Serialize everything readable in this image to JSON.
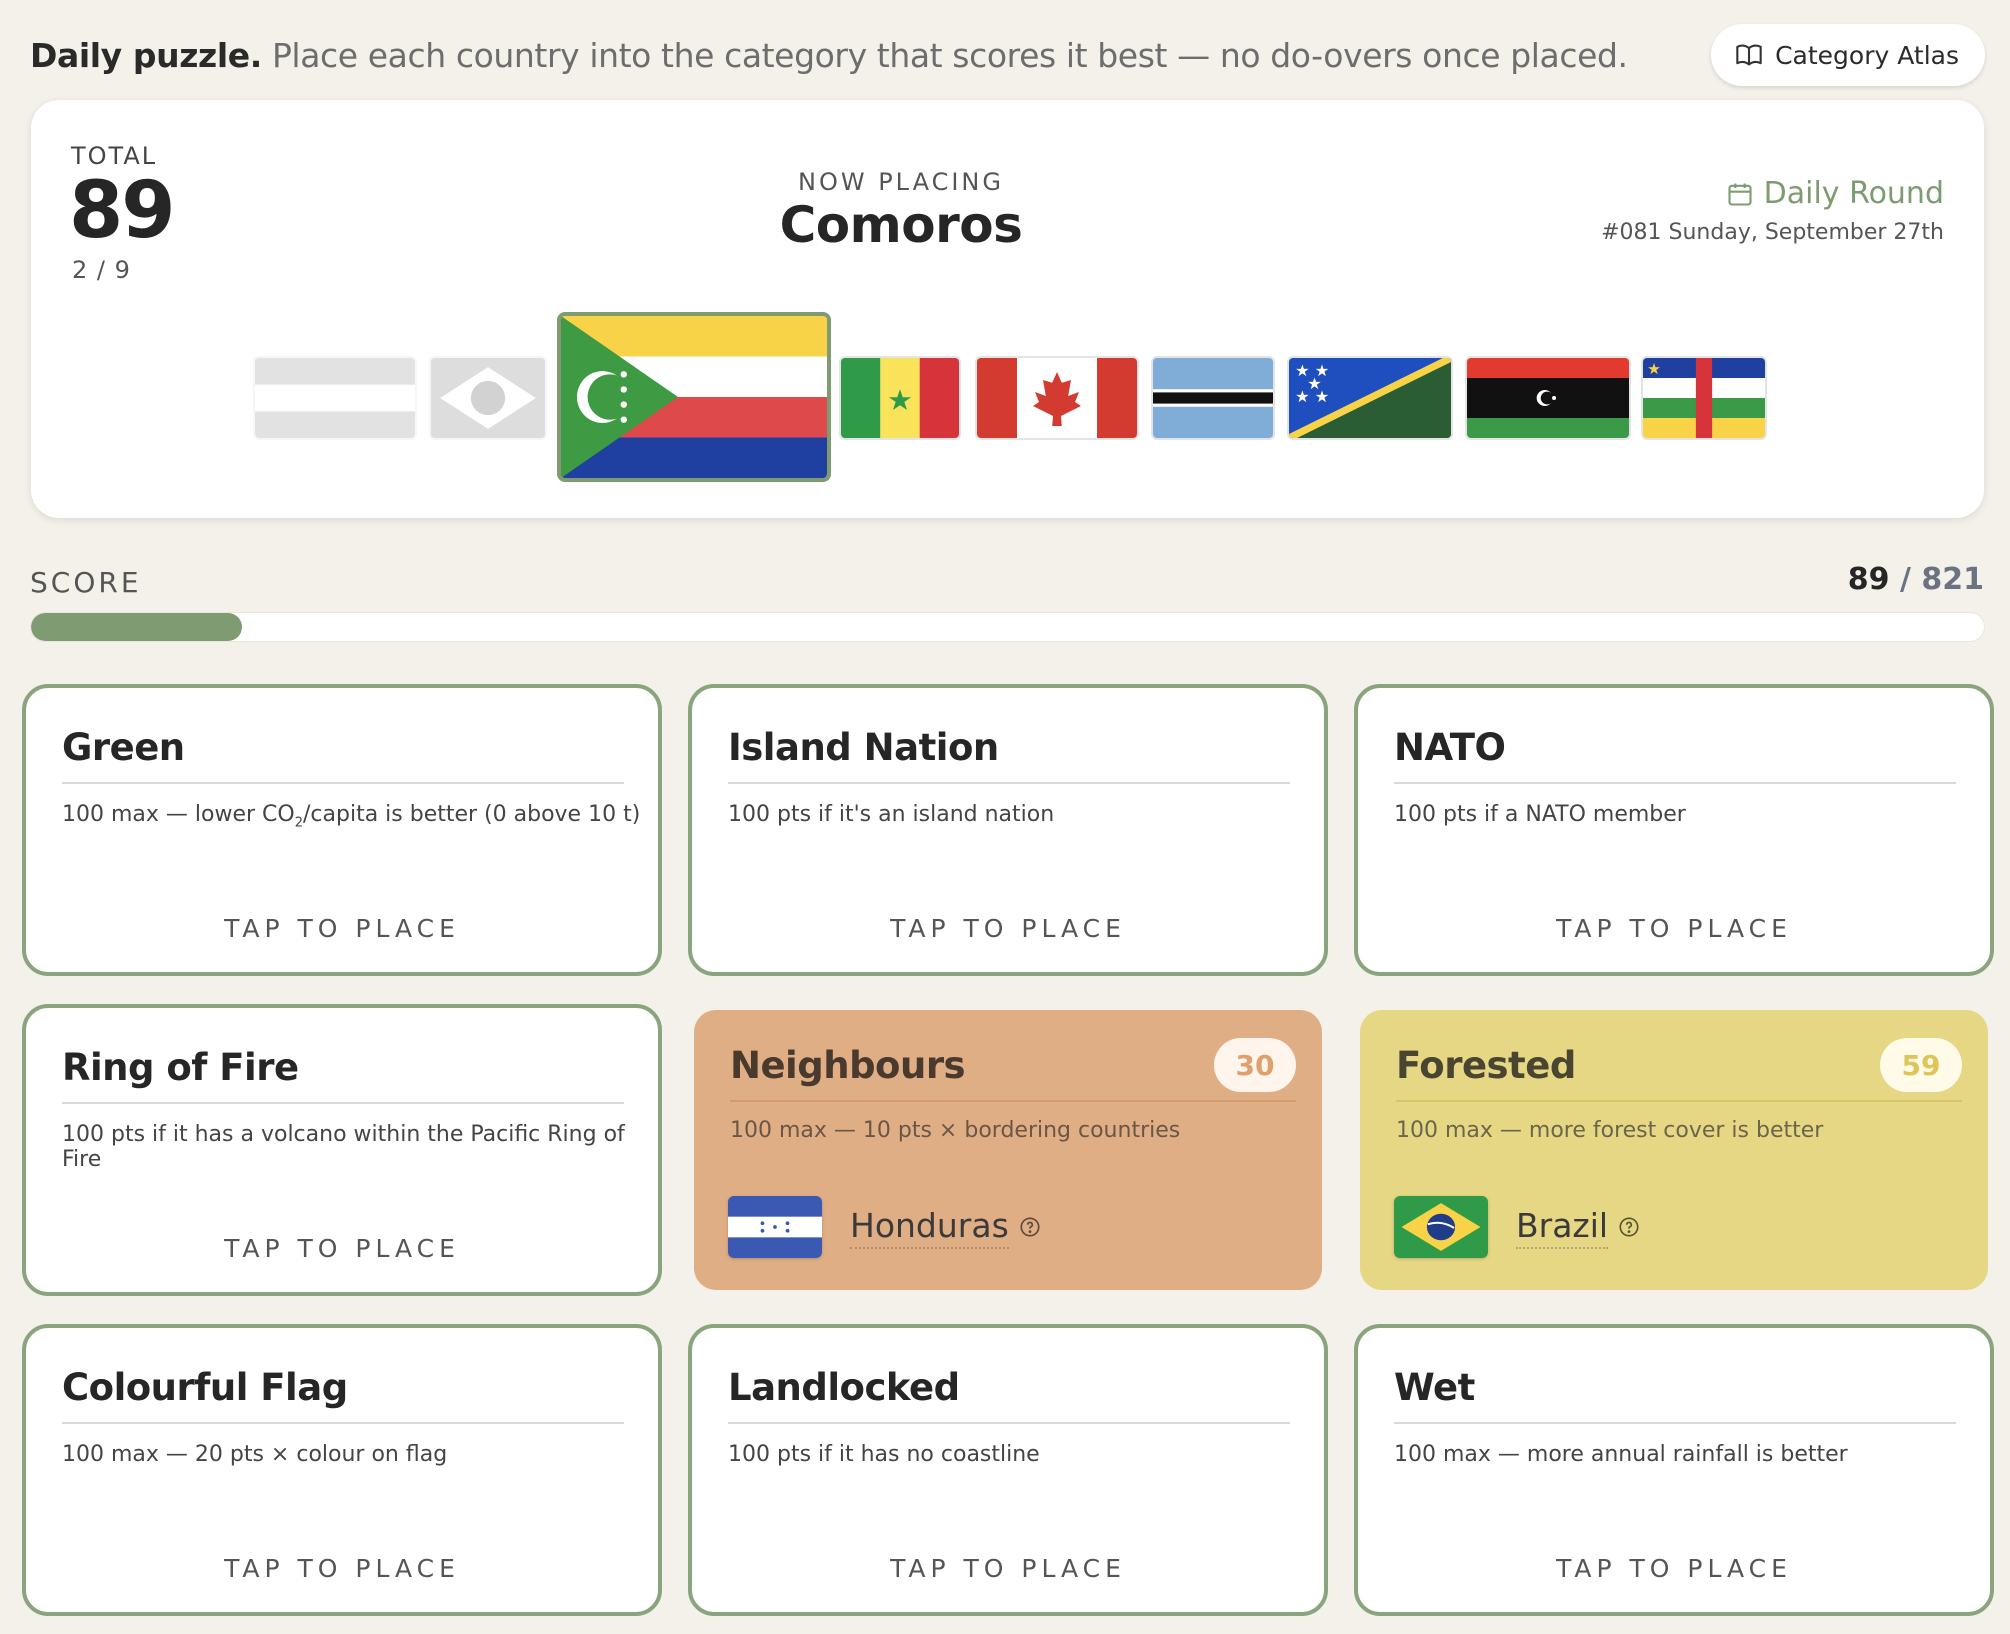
{
  "header": {
    "headline_bold": "Daily puzzle.",
    "headline_rest": "Place each country into the category that scores it best — no do-overs once placed.",
    "atlas_button": "Category Atlas"
  },
  "status": {
    "total_label": "TOTAL",
    "total_value": "89",
    "progress": "2 / 9",
    "now_placing_label": "NOW PLACING",
    "now_placing_country": "Comoros",
    "round_label": "Daily Round",
    "round_date": "#081 Sunday, September 27th"
  },
  "score": {
    "label": "SCORE",
    "current": "89",
    "separator": " / ",
    "max": "821",
    "fill_fraction": 0.108
  },
  "colors": {
    "accent": "#7f9b72",
    "neighbours_card": "#e0ae85",
    "neighbours_text": "#e0a06c",
    "forested_card": "#e6d785",
    "forested_text": "#ddc55a"
  },
  "categories": [
    {
      "title": "Green",
      "desc_pre": "100 max — lower CO",
      "desc_sub": "2",
      "desc_post": "/capita is better (0 above 10 t)",
      "cta": "TAP TO PLACE"
    },
    {
      "title": "Island Nation",
      "desc": "100 pts if it's an island nation",
      "cta": "TAP TO PLACE"
    },
    {
      "title": "NATO",
      "desc": "100 pts if a NATO member",
      "cta": "TAP TO PLACE"
    },
    {
      "title": "Ring of Fire",
      "desc": "100 pts if it has a volcano within the Pacific Ring of Fire",
      "cta": "TAP TO PLACE"
    },
    {
      "title": "Neighbours",
      "desc": "100 max — 10 pts × bordering countries",
      "score": "30",
      "placed_country": "Honduras"
    },
    {
      "title": "Forested",
      "desc": "100 max — more forest cover is better",
      "score": "59",
      "placed_country": "Brazil"
    },
    {
      "title": "Colourful Flag",
      "desc": "100 max — 20 pts × colour on flag",
      "cta": "TAP TO PLACE"
    },
    {
      "title": "Landlocked",
      "desc": "100 pts if it has no coastline",
      "cta": "TAP TO PLACE"
    },
    {
      "title": "Wet",
      "desc": "100 max — more annual rainfall is better",
      "cta": "TAP TO PLACE"
    }
  ]
}
